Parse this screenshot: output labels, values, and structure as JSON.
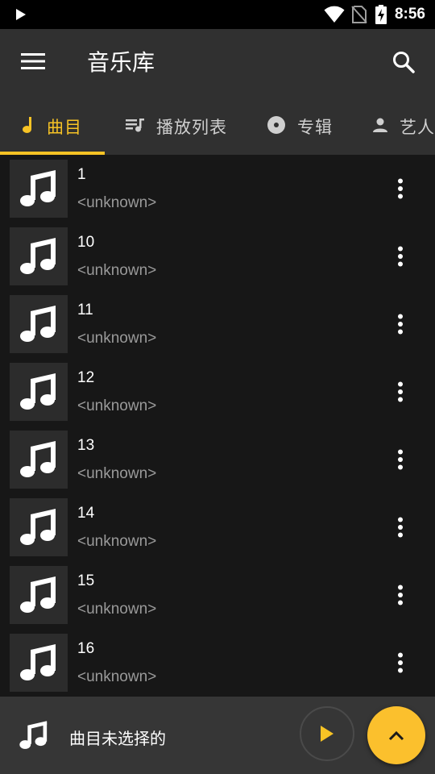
{
  "status_bar": {
    "time": "8:56"
  },
  "app_bar": {
    "title": "音乐库"
  },
  "tabs": [
    {
      "label": "曲目",
      "icon": "music-note-icon",
      "active": true
    },
    {
      "label": "播放列表",
      "icon": "playlist-icon",
      "active": false
    },
    {
      "label": "专辑",
      "icon": "album-icon",
      "active": false
    },
    {
      "label": "艺人",
      "icon": "person-icon",
      "active": false
    }
  ],
  "songs": [
    {
      "title": "1",
      "artist": "<unknown>"
    },
    {
      "title": "10",
      "artist": "<unknown>"
    },
    {
      "title": "11",
      "artist": "<unknown>"
    },
    {
      "title": "12",
      "artist": "<unknown>"
    },
    {
      "title": "13",
      "artist": "<unknown>"
    },
    {
      "title": "14",
      "artist": "<unknown>"
    },
    {
      "title": "15",
      "artist": "<unknown>"
    },
    {
      "title": "16",
      "artist": "<unknown>"
    }
  ],
  "mini_player": {
    "title": "曲目未选择的"
  },
  "colors": {
    "accent": "#f7c325",
    "background": "#171717",
    "toolbar": "#303030",
    "fab": "#fbc02d"
  }
}
